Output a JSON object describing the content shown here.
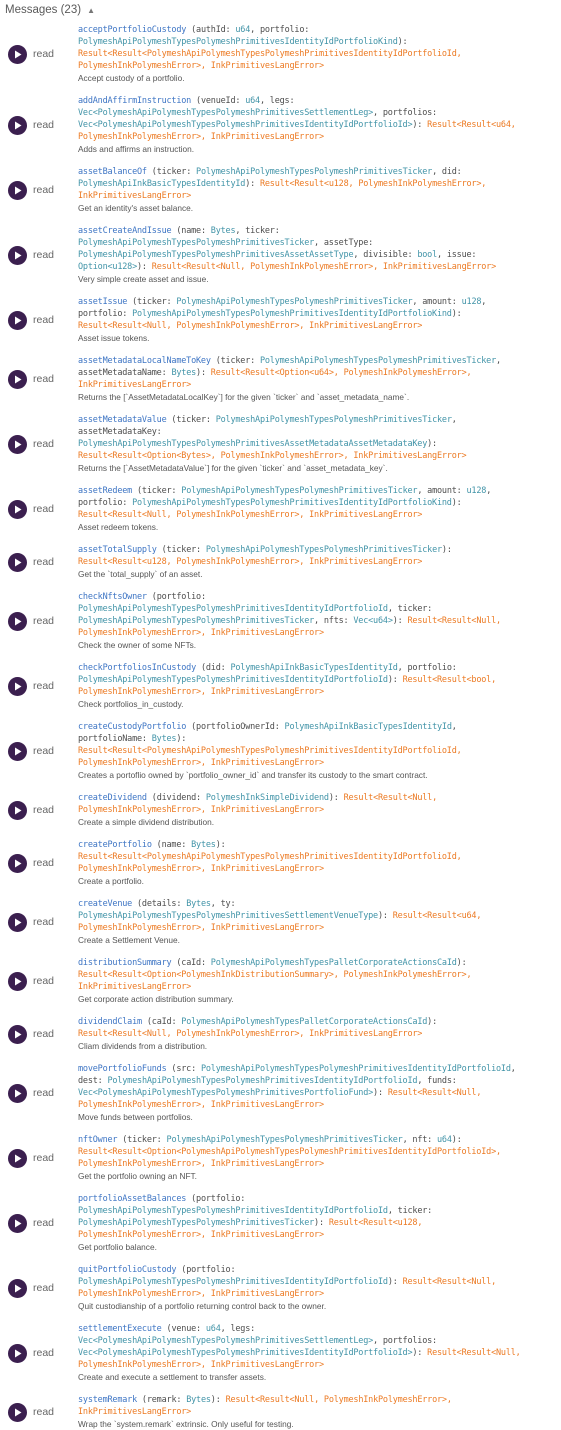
{
  "header": {
    "title": "Messages (23)",
    "toggle_icon": "caret-up-icon"
  },
  "read_label": "read",
  "colors": {
    "name": "#3e75c4",
    "type": "#4294a8",
    "return": "#ec7a23",
    "button": "#3b1f4f"
  },
  "messages": [
    {
      "top": 0,
      "segments": [
        [
          "name",
          "acceptPortfolioCustody"
        ],
        [
          "plain",
          " (authId: "
        ],
        [
          "type",
          "u64"
        ],
        [
          "plain",
          ", portfolio: "
        ],
        [
          "br"
        ],
        [
          "type",
          "PolymeshApiPolymeshTypesPolymeshPrimitivesIdentityIdPortfolioKind"
        ],
        [
          "plain",
          "):"
        ],
        [
          "br"
        ],
        [
          "ret",
          "Result<Result<PolymeshApiPolymeshTypesPolymeshPrimitivesIdentityIdPortfolioId,"
        ],
        [
          "br"
        ],
        [
          "ret",
          "PolymeshInkPolymeshError>, InkPrimitivesLangError>"
        ]
      ],
      "doc": "Accept custody of a portfolio."
    },
    {
      "segments": [
        [
          "name",
          "addAndAffirmInstruction"
        ],
        [
          "plain",
          " (venueId: "
        ],
        [
          "type",
          "u64"
        ],
        [
          "plain",
          ", legs:"
        ],
        [
          "br"
        ],
        [
          "type",
          "Vec<PolymeshApiPolymeshTypesPolymeshPrimitivesSettlementLeg>"
        ],
        [
          "plain",
          ", portfolios:"
        ],
        [
          "br"
        ],
        [
          "type",
          "Vec<PolymeshApiPolymeshTypesPolymeshPrimitivesIdentityIdPortfolioId>"
        ],
        [
          "plain",
          "): "
        ],
        [
          "ret",
          "Result<Result<u64,"
        ],
        [
          "br"
        ],
        [
          "ret",
          "PolymeshInkPolymeshError>, InkPrimitivesLangError>"
        ]
      ],
      "doc": "Adds and affirms an instruction."
    },
    {
      "segments": [
        [
          "name",
          "assetBalanceOf"
        ],
        [
          "plain",
          " (ticker: "
        ],
        [
          "type",
          "PolymeshApiPolymeshTypesPolymeshPrimitivesTicker"
        ],
        [
          "plain",
          ", did:"
        ],
        [
          "br"
        ],
        [
          "type",
          "PolymeshApiInkBasicTypesIdentityId"
        ],
        [
          "plain",
          "): "
        ],
        [
          "ret",
          "Result<Result<u128, PolymeshInkPolymeshError>,"
        ],
        [
          "br"
        ],
        [
          "ret",
          "InkPrimitivesLangError>"
        ]
      ],
      "doc": "Get an identity's asset balance."
    },
    {
      "segments": [
        [
          "name",
          "assetCreateAndIssue"
        ],
        [
          "plain",
          " (name: "
        ],
        [
          "type",
          "Bytes"
        ],
        [
          "plain",
          ", ticker:"
        ],
        [
          "br"
        ],
        [
          "type",
          "PolymeshApiPolymeshTypesPolymeshPrimitivesTicker"
        ],
        [
          "plain",
          ", assetType:"
        ],
        [
          "br"
        ],
        [
          "type",
          "PolymeshApiPolymeshTypesPolymeshPrimitivesAssetAssetType"
        ],
        [
          "plain",
          ", divisible: "
        ],
        [
          "type",
          "bool"
        ],
        [
          "plain",
          ", issue:"
        ],
        [
          "br"
        ],
        [
          "type",
          "Option<u128>"
        ],
        [
          "plain",
          "): "
        ],
        [
          "ret",
          "Result<Result<Null, PolymeshInkPolymeshError>, InkPrimitivesLangError>"
        ]
      ],
      "doc": "Very simple create asset and issue."
    },
    {
      "segments": [
        [
          "name",
          "assetIssue"
        ],
        [
          "plain",
          " (ticker: "
        ],
        [
          "type",
          "PolymeshApiPolymeshTypesPolymeshPrimitivesTicker"
        ],
        [
          "plain",
          ", amount: "
        ],
        [
          "type",
          "u128"
        ],
        [
          "plain",
          ","
        ],
        [
          "br"
        ],
        [
          "plain",
          "portfolio: "
        ],
        [
          "type",
          "PolymeshApiPolymeshTypesPolymeshPrimitivesIdentityIdPortfolioKind"
        ],
        [
          "plain",
          "):"
        ],
        [
          "br"
        ],
        [
          "ret",
          "Result<Result<Null, PolymeshInkPolymeshError>, InkPrimitivesLangError>"
        ]
      ],
      "doc": "Asset issue tokens."
    },
    {
      "segments": [
        [
          "name",
          "assetMetadataLocalNameToKey"
        ],
        [
          "plain",
          " (ticker: "
        ],
        [
          "type",
          "PolymeshApiPolymeshTypesPolymeshPrimitivesTicker"
        ],
        [
          "plain",
          ","
        ],
        [
          "br"
        ],
        [
          "plain",
          "assetMetadataName: "
        ],
        [
          "type",
          "Bytes"
        ],
        [
          "plain",
          "): "
        ],
        [
          "ret",
          "Result<Result<Option<u64>, PolymeshInkPolymeshError>,"
        ],
        [
          "br"
        ],
        [
          "ret",
          "InkPrimitivesLangError>"
        ]
      ],
      "doc": "Returns the [`AssetMetadataLocalKey`] for the given `ticker` and `asset_metadata_name`."
    },
    {
      "segments": [
        [
          "name",
          "assetMetadataValue"
        ],
        [
          "plain",
          " (ticker: "
        ],
        [
          "type",
          "PolymeshApiPolymeshTypesPolymeshPrimitivesTicker"
        ],
        [
          "plain",
          ","
        ],
        [
          "br"
        ],
        [
          "plain",
          "assetMetadataKey:"
        ],
        [
          "br"
        ],
        [
          "type",
          "PolymeshApiPolymeshTypesPolymeshPrimitivesAssetMetadataAssetMetadataKey"
        ],
        [
          "plain",
          "):"
        ],
        [
          "br"
        ],
        [
          "ret",
          "Result<Result<Option<Bytes>, PolymeshInkPolymeshError>, InkPrimitivesLangError>"
        ]
      ],
      "doc": "Returns the [`AssetMetadataValue`] for the given `ticker` and `asset_metadata_key`."
    },
    {
      "segments": [
        [
          "name",
          "assetRedeem"
        ],
        [
          "plain",
          " (ticker: "
        ],
        [
          "type",
          "PolymeshApiPolymeshTypesPolymeshPrimitivesTicker"
        ],
        [
          "plain",
          ", amount: "
        ],
        [
          "type",
          "u128"
        ],
        [
          "plain",
          ","
        ],
        [
          "br"
        ],
        [
          "plain",
          "portfolio: "
        ],
        [
          "type",
          "PolymeshApiPolymeshTypesPolymeshPrimitivesIdentityIdPortfolioKind"
        ],
        [
          "plain",
          "):"
        ],
        [
          "br"
        ],
        [
          "ret",
          "Result<Result<Null, PolymeshInkPolymeshError>, InkPrimitivesLangError>"
        ]
      ],
      "doc": "Asset redeem tokens."
    },
    {
      "segments": [
        [
          "name",
          "assetTotalSupply"
        ],
        [
          "plain",
          " (ticker: "
        ],
        [
          "type",
          "PolymeshApiPolymeshTypesPolymeshPrimitivesTicker"
        ],
        [
          "plain",
          "):"
        ],
        [
          "br"
        ],
        [
          "ret",
          "Result<Result<u128, PolymeshInkPolymeshError>, InkPrimitivesLangError>"
        ]
      ],
      "doc": "Get the `total_supply` of an asset."
    },
    {
      "segments": [
        [
          "name",
          "checkNftsOwner"
        ],
        [
          "plain",
          " (portfolio:"
        ],
        [
          "br"
        ],
        [
          "type",
          "PolymeshApiPolymeshTypesPolymeshPrimitivesIdentityIdPortfolioId"
        ],
        [
          "plain",
          ", ticker:"
        ],
        [
          "br"
        ],
        [
          "type",
          "PolymeshApiPolymeshTypesPolymeshPrimitivesTicker"
        ],
        [
          "plain",
          ", nfts: "
        ],
        [
          "type",
          "Vec<u64>"
        ],
        [
          "plain",
          "): "
        ],
        [
          "ret",
          "Result<Result<Null,"
        ],
        [
          "br"
        ],
        [
          "ret",
          "PolymeshInkPolymeshError>, InkPrimitivesLangError>"
        ]
      ],
      "doc": "Check the owner of some NFTs."
    },
    {
      "segments": [
        [
          "name",
          "checkPortfoliosInCustody"
        ],
        [
          "plain",
          " (did: "
        ],
        [
          "type",
          "PolymeshApiInkBasicTypesIdentityId"
        ],
        [
          "plain",
          ", portfolio:"
        ],
        [
          "br"
        ],
        [
          "type",
          "PolymeshApiPolymeshTypesPolymeshPrimitivesIdentityIdPortfolioId"
        ],
        [
          "plain",
          "): "
        ],
        [
          "ret",
          "Result<Result<bool,"
        ],
        [
          "br"
        ],
        [
          "ret",
          "PolymeshInkPolymeshError>, InkPrimitivesLangError>"
        ]
      ],
      "doc": "Check portfolios_in_custody."
    },
    {
      "segments": [
        [
          "name",
          "createCustodyPortfolio"
        ],
        [
          "plain",
          " (portfolioOwnerId: "
        ],
        [
          "type",
          "PolymeshApiInkBasicTypesIdentityId"
        ],
        [
          "plain",
          ","
        ],
        [
          "br"
        ],
        [
          "plain",
          "portfolioName: "
        ],
        [
          "type",
          "Bytes"
        ],
        [
          "plain",
          "):"
        ],
        [
          "br"
        ],
        [
          "ret",
          "Result<Result<PolymeshApiPolymeshTypesPolymeshPrimitivesIdentityIdPortfolioId,"
        ],
        [
          "br"
        ],
        [
          "ret",
          "PolymeshInkPolymeshError>, InkPrimitivesLangError>"
        ]
      ],
      "doc": "Creates a portoflio owned by `portfolio_owner_id` and transfer its custody to the smart contract."
    },
    {
      "segments": [
        [
          "name",
          "createDividend"
        ],
        [
          "plain",
          " (dividend: "
        ],
        [
          "type",
          "PolymeshInkSimpleDividend"
        ],
        [
          "plain",
          "): "
        ],
        [
          "ret",
          "Result<Result<Null,"
        ],
        [
          "br"
        ],
        [
          "ret",
          "PolymeshInkPolymeshError>, InkPrimitivesLangError>"
        ]
      ],
      "doc": "Create a simple dividend distribution."
    },
    {
      "segments": [
        [
          "name",
          "createPortfolio"
        ],
        [
          "plain",
          " (name: "
        ],
        [
          "type",
          "Bytes"
        ],
        [
          "plain",
          "):"
        ],
        [
          "br"
        ],
        [
          "ret",
          "Result<Result<PolymeshApiPolymeshTypesPolymeshPrimitivesIdentityIdPortfolioId,"
        ],
        [
          "br"
        ],
        [
          "ret",
          "PolymeshInkPolymeshError>, InkPrimitivesLangError>"
        ]
      ],
      "doc": "Create a portfolio."
    },
    {
      "segments": [
        [
          "name",
          "createVenue"
        ],
        [
          "plain",
          " (details: "
        ],
        [
          "type",
          "Bytes"
        ],
        [
          "plain",
          ", ty:"
        ],
        [
          "br"
        ],
        [
          "type",
          "PolymeshApiPolymeshTypesPolymeshPrimitivesSettlementVenueType"
        ],
        [
          "plain",
          "): "
        ],
        [
          "ret",
          "Result<Result<u64,"
        ],
        [
          "br"
        ],
        [
          "ret",
          "PolymeshInkPolymeshError>, InkPrimitivesLangError>"
        ]
      ],
      "doc": "Create a Settlement Venue."
    },
    {
      "segments": [
        [
          "name",
          "distributionSummary"
        ],
        [
          "plain",
          " (caId: "
        ],
        [
          "type",
          "PolymeshApiPolymeshTypesPalletCorporateActionsCaId"
        ],
        [
          "plain",
          "):"
        ],
        [
          "br"
        ],
        [
          "ret",
          "Result<Result<Option<PolymeshInkDistributionSummary>, PolymeshInkPolymeshError>,"
        ],
        [
          "br"
        ],
        [
          "ret",
          "InkPrimitivesLangError>"
        ]
      ],
      "doc": "Get corporate action distribution summary."
    },
    {
      "segments": [
        [
          "name",
          "dividendClaim"
        ],
        [
          "plain",
          " (caId: "
        ],
        [
          "type",
          "PolymeshApiPolymeshTypesPalletCorporateActionsCaId"
        ],
        [
          "plain",
          "):"
        ],
        [
          "br"
        ],
        [
          "ret",
          "Result<Result<Null, PolymeshInkPolymeshError>, InkPrimitivesLangError>"
        ]
      ],
      "doc": "Cliam dividends from a distribution."
    },
    {
      "segments": [
        [
          "name",
          "movePortfolioFunds"
        ],
        [
          "plain",
          " (src: "
        ],
        [
          "type",
          "PolymeshApiPolymeshTypesPolymeshPrimitivesIdentityIdPortfolioId"
        ],
        [
          "plain",
          ","
        ],
        [
          "br"
        ],
        [
          "plain",
          "dest: "
        ],
        [
          "type",
          "PolymeshApiPolymeshTypesPolymeshPrimitivesIdentityIdPortfolioId"
        ],
        [
          "plain",
          ", funds:"
        ],
        [
          "br"
        ],
        [
          "type",
          "Vec<PolymeshApiPolymeshTypesPolymeshPrimitivesPortfolioFund>"
        ],
        [
          "plain",
          "): "
        ],
        [
          "ret",
          "Result<Result<Null,"
        ],
        [
          "br"
        ],
        [
          "ret",
          "PolymeshInkPolymeshError>, InkPrimitivesLangError>"
        ]
      ],
      "doc": "Move funds between portfolios."
    },
    {
      "segments": [
        [
          "name",
          "nftOwner"
        ],
        [
          "plain",
          " (ticker: "
        ],
        [
          "type",
          "PolymeshApiPolymeshTypesPolymeshPrimitivesTicker"
        ],
        [
          "plain",
          ", nft: "
        ],
        [
          "type",
          "u64"
        ],
        [
          "plain",
          "):"
        ],
        [
          "br"
        ],
        [
          "ret",
          "Result<Result<Option<PolymeshApiPolymeshTypesPolymeshPrimitivesIdentityIdPortfolioId>,"
        ],
        [
          "br"
        ],
        [
          "ret",
          "PolymeshInkPolymeshError>, InkPrimitivesLangError>"
        ]
      ],
      "doc": "Get the portfolio owning an NFT."
    },
    {
      "segments": [
        [
          "name",
          "portfolioAssetBalances"
        ],
        [
          "plain",
          " (portfolio:"
        ],
        [
          "br"
        ],
        [
          "type",
          "PolymeshApiPolymeshTypesPolymeshPrimitivesIdentityIdPortfolioId"
        ],
        [
          "plain",
          ", ticker:"
        ],
        [
          "br"
        ],
        [
          "type",
          "PolymeshApiPolymeshTypesPolymeshPrimitivesTicker"
        ],
        [
          "plain",
          "): "
        ],
        [
          "ret",
          "Result<Result<u128,"
        ],
        [
          "br"
        ],
        [
          "ret",
          "PolymeshInkPolymeshError>, InkPrimitivesLangError>"
        ]
      ],
      "doc": "Get portfolio balance."
    },
    {
      "segments": [
        [
          "name",
          "quitPortfolioCustody"
        ],
        [
          "plain",
          " (portfolio:"
        ],
        [
          "br"
        ],
        [
          "type",
          "PolymeshApiPolymeshTypesPolymeshPrimitivesIdentityIdPortfolioId"
        ],
        [
          "plain",
          "): "
        ],
        [
          "ret",
          "Result<Result<Null,"
        ],
        [
          "br"
        ],
        [
          "ret",
          "PolymeshInkPolymeshError>, InkPrimitivesLangError>"
        ]
      ],
      "doc": "Quit custodianship of a portfolio returning control back to the owner."
    },
    {
      "segments": [
        [
          "name",
          "settlementExecute"
        ],
        [
          "plain",
          " (venue: "
        ],
        [
          "type",
          "u64"
        ],
        [
          "plain",
          ", legs:"
        ],
        [
          "br"
        ],
        [
          "type",
          "Vec<PolymeshApiPolymeshTypesPolymeshPrimitivesSettlementLeg>"
        ],
        [
          "plain",
          ", portfolios:"
        ],
        [
          "br"
        ],
        [
          "type",
          "Vec<PolymeshApiPolymeshTypesPolymeshPrimitivesIdentityIdPortfolioId>"
        ],
        [
          "plain",
          "): "
        ],
        [
          "ret",
          "Result<Result<Null,"
        ],
        [
          "br"
        ],
        [
          "ret",
          "PolymeshInkPolymeshError>, InkPrimitivesLangError>"
        ]
      ],
      "doc": "Create and execute a settlement to transfer assets."
    },
    {
      "segments": [
        [
          "name",
          "systemRemark"
        ],
        [
          "plain",
          " (remark: "
        ],
        [
          "type",
          "Bytes"
        ],
        [
          "plain",
          "): "
        ],
        [
          "ret",
          "Result<Result<Null, PolymeshInkPolymeshError>,"
        ],
        [
          "br"
        ],
        [
          "ret",
          "InkPrimitivesLangError>"
        ]
      ],
      "doc": "Wrap the `system.remark` extrinsic. Only useful for testing."
    }
  ]
}
